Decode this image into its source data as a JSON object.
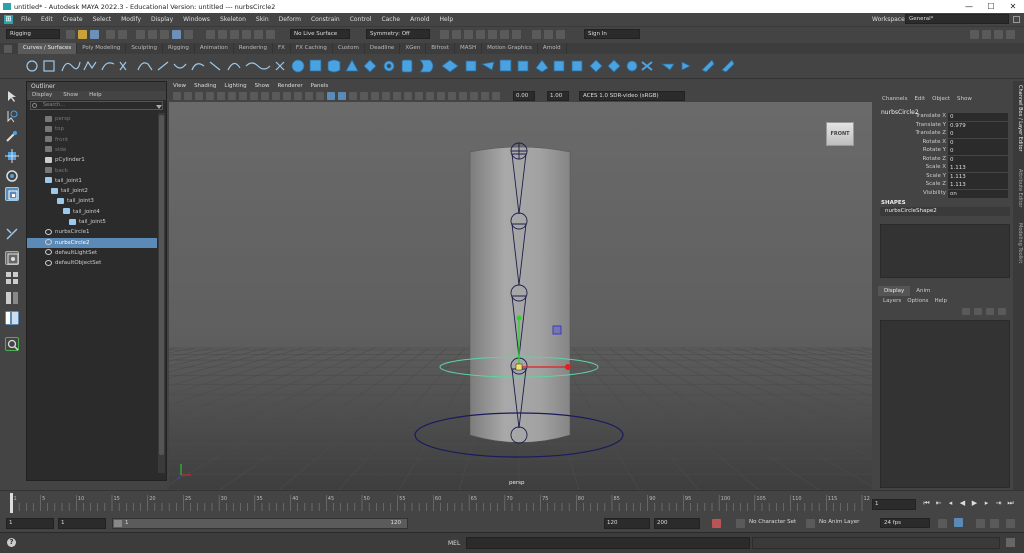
{
  "window": {
    "title": "untitled* - Autodesk MAYA 2022.3 - Educational Version: untitled  ---  nurbsCircle2",
    "minimize": "—",
    "maximize": "☐",
    "close": "✕"
  },
  "menubar": {
    "items": [
      "File",
      "Edit",
      "Create",
      "Select",
      "Modify",
      "Display",
      "Windows",
      "Skeleton",
      "Skin",
      "Deform",
      "Constrain",
      "Control",
      "Cache",
      "Arnold",
      "Help"
    ],
    "workspace_label": "Workspace:",
    "workspace_value": "General*"
  },
  "statusline": {
    "menuset": "Rigging",
    "live_surface": "No Live Surface",
    "symmetry": "Symmetry: Off",
    "sign_in": "Sign In"
  },
  "shelf": {
    "tabs": [
      "Curves / Surfaces",
      "Poly Modeling",
      "Sculpting",
      "Rigging",
      "Animation",
      "Rendering",
      "FX",
      "FX Caching",
      "Custom",
      "Deadline",
      "XGen",
      "Bifrost",
      "MASH",
      "Motion Graphics",
      "Arnold"
    ],
    "active_tab": "Curves / Surfaces"
  },
  "outliner": {
    "title": "Outliner",
    "menu": [
      "Display",
      "Show",
      "Help"
    ],
    "search_placeholder": "Search...",
    "items": [
      {
        "label": "persp",
        "indent": 0,
        "type": "camera",
        "dim": true
      },
      {
        "label": "top",
        "indent": 0,
        "type": "camera",
        "dim": true
      },
      {
        "label": "front",
        "indent": 0,
        "type": "camera",
        "dim": true
      },
      {
        "label": "side",
        "indent": 0,
        "type": "camera",
        "dim": true
      },
      {
        "label": "pCylinder1",
        "indent": 0,
        "type": "mesh",
        "dim": false
      },
      {
        "label": "back",
        "indent": 0,
        "type": "camera",
        "dim": true
      },
      {
        "label": "tail_joint1",
        "indent": 0,
        "type": "joint",
        "dim": false
      },
      {
        "label": "tail_joint2",
        "indent": 1,
        "type": "joint",
        "dim": false
      },
      {
        "label": "tail_joint3",
        "indent": 2,
        "type": "joint",
        "dim": false
      },
      {
        "label": "tail_joint4",
        "indent": 3,
        "type": "joint",
        "dim": false
      },
      {
        "label": "tail_joint5",
        "indent": 4,
        "type": "joint",
        "dim": false
      },
      {
        "label": "nurbsCircle1",
        "indent": 0,
        "type": "curve",
        "dim": false
      },
      {
        "label": "nurbsCircle2",
        "indent": 0,
        "type": "curve",
        "dim": false,
        "selected": true
      },
      {
        "label": "defaultLightSet",
        "indent": 0,
        "type": "set",
        "dim": false
      },
      {
        "label": "defaultObjectSet",
        "indent": 0,
        "type": "set",
        "dim": false
      }
    ]
  },
  "viewport": {
    "menu": [
      "View",
      "Shading",
      "Lighting",
      "Show",
      "Renderer",
      "Panels"
    ],
    "field1": "0.00",
    "field2": "1.00",
    "colorspace": "ACES 1.0 SDR-video (sRGB)",
    "camera_label": "persp",
    "viewcube": "FRONT"
  },
  "channelbox": {
    "menu": [
      "Channels",
      "Edit",
      "Object",
      "Show"
    ],
    "object": "nurbsCircle2",
    "attributes": [
      {
        "name": "Translate X",
        "value": "0"
      },
      {
        "name": "Translate Y",
        "value": "0.979"
      },
      {
        "name": "Translate Z",
        "value": "0"
      },
      {
        "name": "Rotate X",
        "value": "0"
      },
      {
        "name": "Rotate Y",
        "value": "0"
      },
      {
        "name": "Rotate Z",
        "value": "0"
      },
      {
        "name": "Scale X",
        "value": "1.113"
      },
      {
        "name": "Scale Y",
        "value": "1.113"
      },
      {
        "name": "Scale Z",
        "value": "1.113"
      },
      {
        "name": "Visibility",
        "value": "on"
      }
    ],
    "shapes_label": "SHAPES",
    "shape_name": "nurbsCircleShape2"
  },
  "sidetabs": [
    "Channel Box / Layer Editor",
    "Attribute Editor",
    "Modeling Toolkit"
  ],
  "layereditor": {
    "tabs": [
      "Display",
      "Anim"
    ],
    "menu": [
      "Layers",
      "Options",
      "Help"
    ]
  },
  "timeline": {
    "ticks": [
      "1",
      "5",
      "10",
      "15",
      "20",
      "25",
      "30",
      "35",
      "40",
      "45",
      "50",
      "55",
      "60",
      "65",
      "70",
      "75",
      "80",
      "85",
      "90",
      "95",
      "100",
      "105",
      "110",
      "115",
      "120"
    ],
    "current_frame": "1"
  },
  "range": {
    "start": "1",
    "start2": "1",
    "range_start_val": "1",
    "range_end_val": "120",
    "end": "120",
    "end2": "200",
    "character_set": "No Character Set",
    "anim_layer": "No Anim Layer",
    "fps": "24 fps"
  },
  "cmdline": {
    "lang": "MEL"
  }
}
